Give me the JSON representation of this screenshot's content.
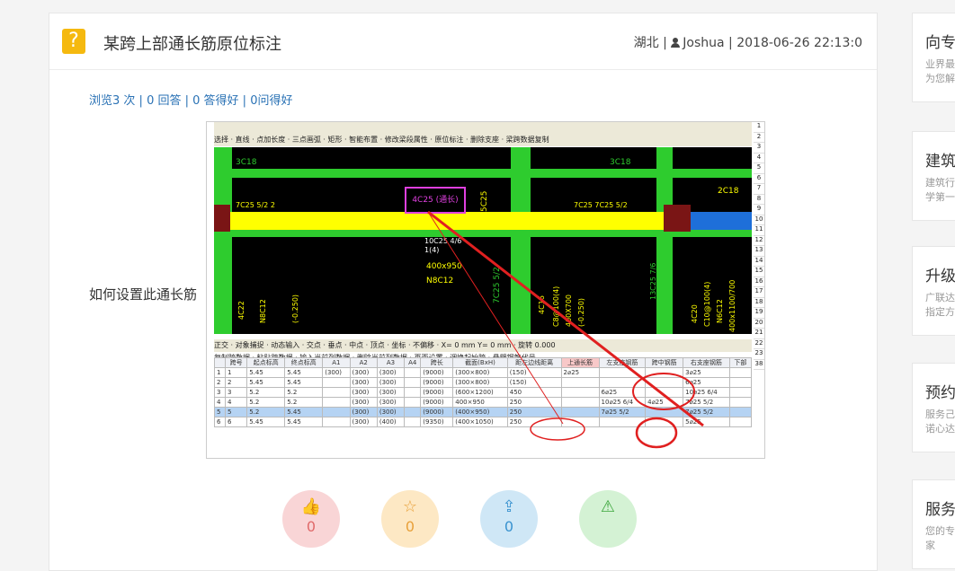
{
  "header": {
    "title": "某跨上部通长筋原位标注",
    "region": "湖北",
    "sep": "|",
    "user": "Joshua",
    "date": "2018-06-26 22:13:0"
  },
  "stats": {
    "views": "浏览3 次",
    "answers": "0 回答",
    "good": "0 答得好",
    "liked": "0问得好"
  },
  "question": "如何设置此通长筋",
  "screenshot": {
    "toolbar1": "选择 · 直线 · 点加长度 · 三点画弧 · 矩形 · 智能布置 · 修改梁段属性 · 原位标注 · 删除支座 · 梁跨数据复制",
    "toolbar2": "正交 · 对象捕捉 · 动态输入 · 交点 · 垂点 · 中点 · 顶点 · 坐标 · 不偏移 · X= 0 mm Y= 0 mm · 旋转 0.000",
    "toolbar3": "复制跨数据 · 粘贴跨数据 · 输入当前列数据 · 删除当前列数据 · 页面设置 · 调换起始跨 · 悬臂钢筋代号",
    "labels": {
      "top_left": "3C18",
      "top_right": "3C18",
      "right_edge": "2C18",
      "left_mid": "7C25 5/2 2",
      "right_mid": "7C25 7C25 5/2",
      "highlight": "4C25 (通长)",
      "vert1": "5C25",
      "mid1": "10C25 4/6",
      "mid2": "1(4)",
      "size": "400x950",
      "stirrup": "N8C12",
      "vert2": "7C25 5/2",
      "vert3": "4C16",
      "vert4": "C8@100(4)",
      "vert5": "400X700",
      "vert6": "(-0.250)",
      "vert7": "13C25 7/6",
      "vert8": "4C20",
      "vert9": "C10@100(4)",
      "vert10": "N6C12",
      "vert11": "400x1100/700",
      "left_v1": "4C22",
      "left_v2": "N8C12",
      "left_v3": "(-0.250)"
    },
    "row_numbers": [
      "1",
      "2",
      "3",
      "4",
      "5",
      "6",
      "7",
      "8",
      "9",
      "10",
      "11",
      "12",
      "13",
      "14",
      "15",
      "16",
      "17",
      "18",
      "19",
      "20",
      "21",
      "22",
      "23",
      "38"
    ],
    "table": {
      "headers": [
        "",
        "跨号",
        "起点标高",
        "终点标高",
        "A1",
        "A2",
        "A3",
        "A4",
        "跨长",
        "截面(BxH)",
        "距左边线距离",
        "上通长筋",
        "左支座钢筋",
        "跨中钢筋",
        "右支座钢筋",
        "下部"
      ],
      "group_headers": {
        "elev": "标高(m)",
        "size": "构件尺寸(mm)",
        "top": "上部钢筋"
      },
      "rows": [
        [
          "1",
          "1",
          "5.45",
          "5.45",
          "(300)",
          "(300)",
          "(300)",
          "",
          "(9000)",
          "(300×800)",
          "(150)",
          "2⌀25",
          "",
          "",
          "3⌀25",
          ""
        ],
        [
          "2",
          "2",
          "5.45",
          "5.45",
          "",
          "(300)",
          "(300)",
          "",
          "(9000)",
          "(300×800)",
          "(150)",
          "",
          "",
          "",
          "6⌀25",
          ""
        ],
        [
          "3",
          "3",
          "5.2",
          "5.2",
          "",
          "(300)",
          "(300)",
          "",
          "(9000)",
          "(600×1200)",
          "450",
          "",
          "6⌀25",
          "",
          "10⌀25 6/4",
          ""
        ],
        [
          "4",
          "4",
          "5.2",
          "5.2",
          "",
          "(300)",
          "(300)",
          "",
          "(9000)",
          "400×950",
          "250",
          "",
          "10⌀25 6/4",
          "4⌀25",
          "7⌀25 5/2",
          ""
        ],
        [
          "5",
          "5",
          "5.2",
          "5.45",
          "",
          "(300)",
          "(300)",
          "",
          "(9000)",
          "(400×950)",
          "250",
          "",
          "7⌀25 5/2",
          "",
          "7⌀25 5/2",
          ""
        ],
        [
          "6",
          "6",
          "5.45",
          "5.45",
          "",
          "(300)",
          "(400)",
          "",
          "(9350)",
          "(400×1050)",
          "250",
          "",
          "",
          "",
          "5⌀25",
          ""
        ]
      ]
    }
  },
  "reactions": [
    {
      "icon": "thumbs-up-icon",
      "glyph": "👍",
      "count": "0",
      "color": "#f9d5d6",
      "fg": "#e06a6a"
    },
    {
      "icon": "star-icon",
      "glyph": "☆",
      "count": "0",
      "color": "#fde8c4",
      "fg": "#e8a03a"
    },
    {
      "icon": "share-icon",
      "glyph": "⇪",
      "count": "0",
      "color": "#cfe7f6",
      "fg": "#3a93d0"
    },
    {
      "icon": "warning-icon",
      "glyph": "⚠",
      "count": "",
      "color": "#d4f2d4",
      "fg": "#3aa53a"
    }
  ],
  "sidebar": [
    {
      "title": "向专",
      "desc1": "业界最",
      "desc2": "为您解"
    },
    {
      "title": "建筑",
      "desc1": "建筑行",
      "desc2": "学第一"
    },
    {
      "title": "升级",
      "desc1": "广联达",
      "desc2": "指定方"
    },
    {
      "title": "预约",
      "desc1": "服务己",
      "desc2": "诺心达"
    },
    {
      "title": "服务",
      "desc1": "您的专",
      "desc2": "家"
    }
  ]
}
